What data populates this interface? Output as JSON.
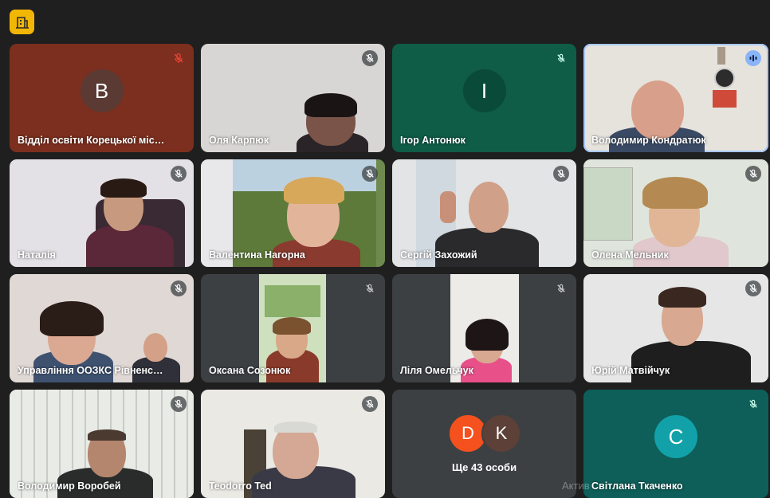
{
  "app": {
    "icon": "meet-building-icon",
    "accent": "#f2b705"
  },
  "participants": [
    {
      "name": "Відділ освіти Корецької міської р...",
      "avatar_letter": "B",
      "mic": "muted-red"
    },
    {
      "name": "Оля Карпюк",
      "mic": "muted"
    },
    {
      "name": "Ігор Антонюк",
      "avatar_letter": "I",
      "mic": "muted"
    },
    {
      "name": "Володимир Кондратюк",
      "mic": "speaking"
    },
    {
      "name": "Наталія",
      "mic": "muted"
    },
    {
      "name": "Валентина Нагорна",
      "mic": "muted"
    },
    {
      "name": "Сергій Захожий",
      "mic": "muted"
    },
    {
      "name": "Олена Мельник",
      "mic": "muted"
    },
    {
      "name": "Управління ООЗКС Рівненської Р...",
      "mic": "muted"
    },
    {
      "name": "Оксана Созонюк",
      "mic": "muted"
    },
    {
      "name": "Ліля Омельчук",
      "mic": "muted"
    },
    {
      "name": "Юрій Матвійчук",
      "mic": "muted"
    },
    {
      "name": "Володимир Воробей",
      "mic": "muted"
    },
    {
      "name": "Teodorro Ted",
      "mic": "muted"
    },
    {
      "name": "Світлана Ткаченко",
      "avatar_letter": "C",
      "mic": "muted"
    }
  ],
  "more": {
    "label": "Ще 43 особи",
    "letters": [
      "D",
      "K"
    ]
  },
  "watermark": "Актив",
  "colors": {
    "muted_red": "#ea4335",
    "speaking_badge": "#8ab4f8",
    "teal": "#0e5f59"
  }
}
